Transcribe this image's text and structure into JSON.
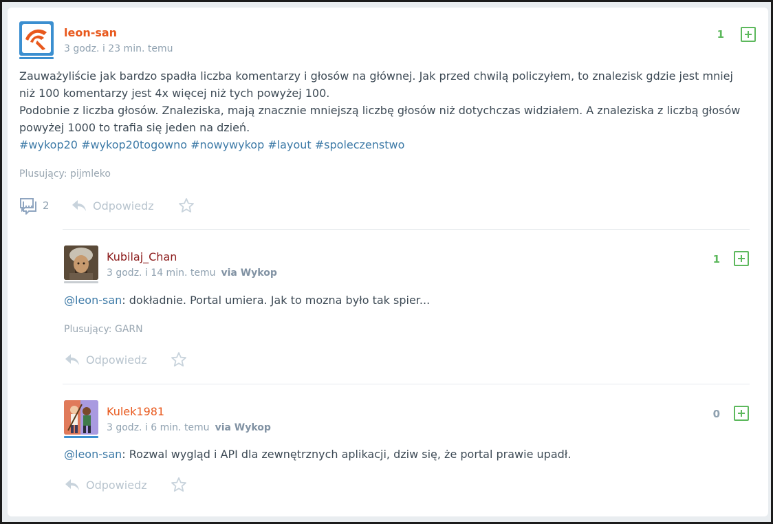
{
  "entry": {
    "username": "leon-san",
    "time": "3 godz. i 23 min. temu",
    "score": "1",
    "body_line1": "Zauważyliście jak bardzo spadła liczba komentarzy i głosów na głównej. Jak przed chwilą policzyłem, to znalezisk gdzie jest mniej",
    "body_line2": "niż 100 komentarzy jest 4x więcej niż tych powyżej 100.",
    "body_line3": "Podobnie z liczba głosów. Znaleziska, mają znacznie mniejszą liczbę głosów niż dotychczas widziałem. A znaleziska z liczbą głosów",
    "body_line4": "powyżej 1000 to trafia się jeden na dzień.",
    "tags": [
      "#wykop20",
      "#wykop20togowno",
      "#nowywykop",
      "#layout",
      "#spoleczenstwo"
    ],
    "plusing": "Plusujący: pijmleko",
    "comments_count": "2",
    "reply_label": "Odpowiedz",
    "colors": {
      "username": "#e8581c",
      "score": "#5cb85c"
    }
  },
  "comments": [
    {
      "username": "Kubilaj_Chan",
      "time": "3 godz. i 14 min. temu",
      "via": "via Wykop",
      "score": "1",
      "mention": "@leon-san",
      "text": ": dokładnie. Portal umiera. Jak to mozna było tak spier...",
      "plusing": "Plusujący: GARN",
      "reply_label": "Odpowiedz",
      "colors": {
        "username": "#8b1a1a",
        "score": "#5cb85c"
      }
    },
    {
      "username": "Kulek1981",
      "time": "3 godz. i 6 min. temu",
      "via": "via Wykop",
      "score": "0",
      "mention": "@leon-san",
      "text": ": Rozwal wygląd i API dla zewnętrznych aplikacji, dziw się, że portal prawie upadł.",
      "reply_label": "Odpowiedz",
      "colors": {
        "username": "#e8581c",
        "score": "#8fa1b0"
      }
    }
  ]
}
